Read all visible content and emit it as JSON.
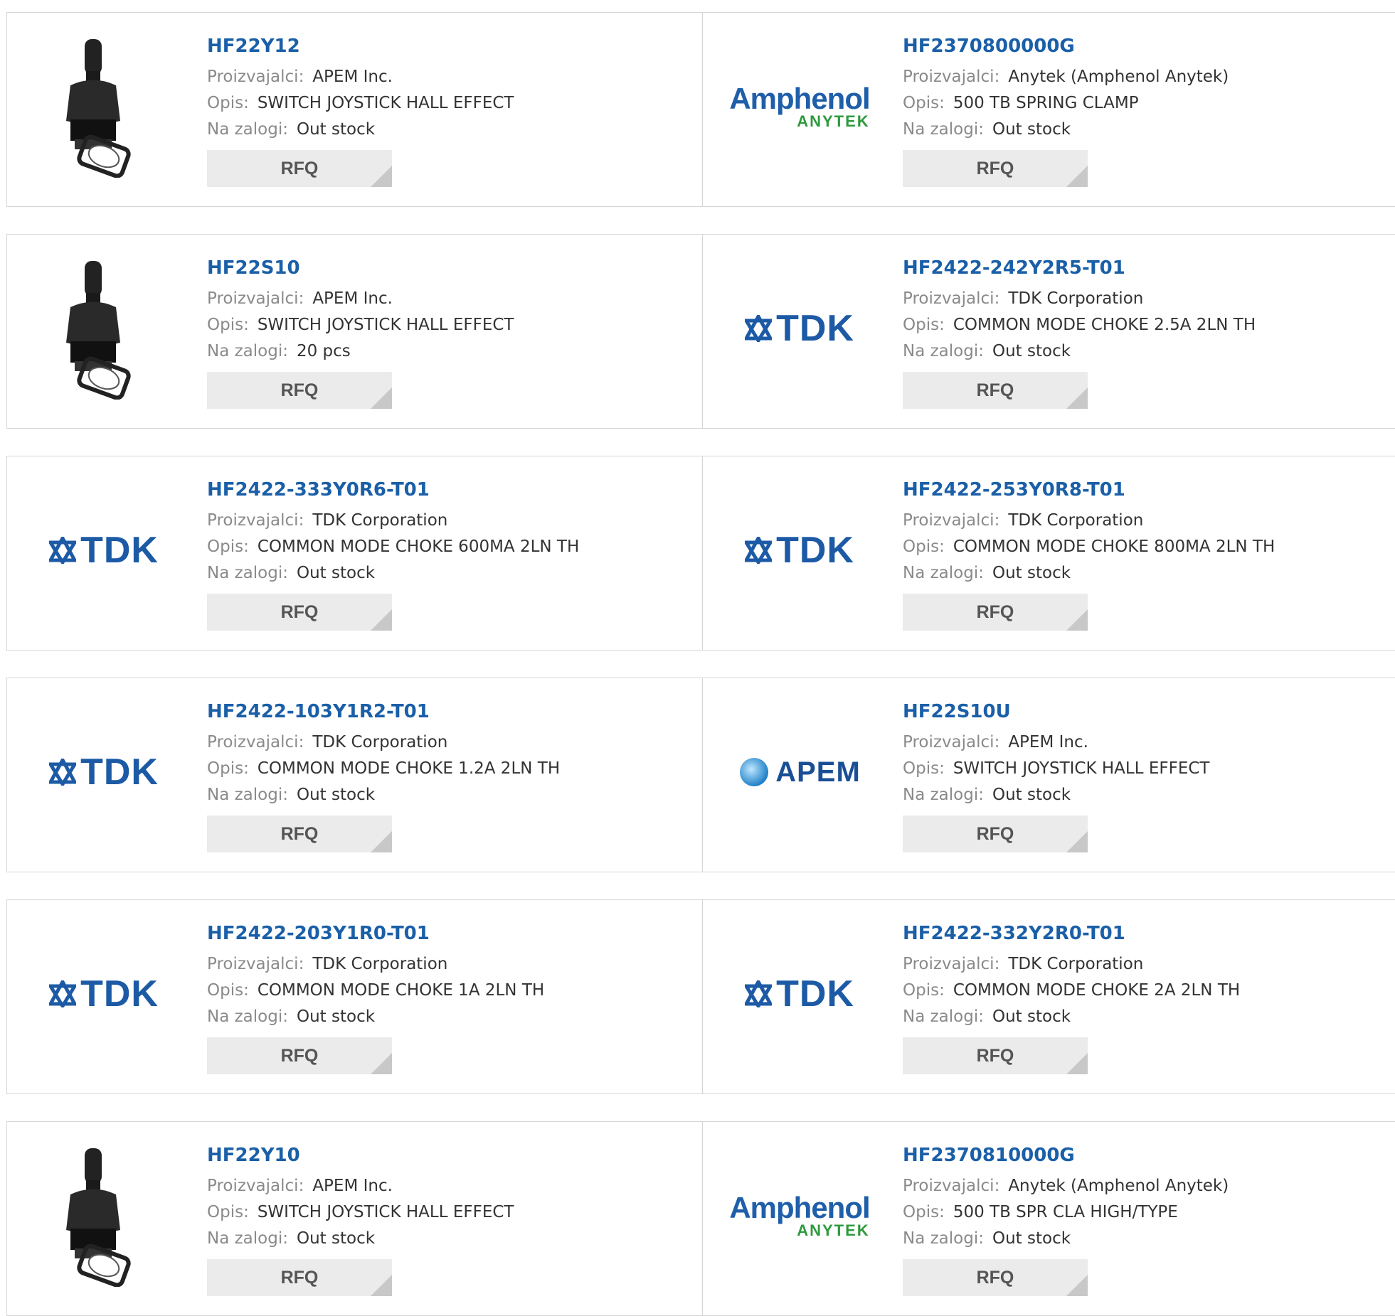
{
  "labels": {
    "manufacturer": "Proizvajalci:",
    "description": "Opis:",
    "stock": "Na zalogi:",
    "rfq": "RFQ"
  },
  "products": [
    {
      "part": "HF22Y12",
      "manufacturer": "APEM Inc.",
      "description": "SWITCH JOYSTICK HALL EFFECT",
      "stock": "Out stock",
      "image": "joystick"
    },
    {
      "part": "HF2370800000G",
      "manufacturer": "Anytek (Amphenol Anytek)",
      "description": "500 TB SPRING CLAMP",
      "stock": "Out stock",
      "image": "amphenol",
      "logo_line1": "Amphenol",
      "logo_line2": "ANYTEK"
    },
    {
      "part": "HF22S10",
      "manufacturer": "APEM Inc.",
      "description": "SWITCH JOYSTICK HALL EFFECT",
      "stock": "20 pcs",
      "image": "joystick"
    },
    {
      "part": "HF2422-242Y2R5-T01",
      "manufacturer": "TDK Corporation",
      "description": "COMMON MODE CHOKE 2.5A 2LN TH",
      "stock": "Out stock",
      "image": "tdk",
      "logo_line1": "TDK"
    },
    {
      "part": "HF2422-333Y0R6-T01",
      "manufacturer": "TDK Corporation",
      "description": "COMMON MODE CHOKE 600MA 2LN TH",
      "stock": "Out stock",
      "image": "tdk",
      "logo_line1": "TDK"
    },
    {
      "part": "HF2422-253Y0R8-T01",
      "manufacturer": "TDK Corporation",
      "description": "COMMON MODE CHOKE 800MA 2LN TH",
      "stock": "Out stock",
      "image": "tdk",
      "logo_line1": "TDK"
    },
    {
      "part": "HF2422-103Y1R2-T01",
      "manufacturer": "TDK Corporation",
      "description": "COMMON MODE CHOKE 1.2A 2LN TH",
      "stock": "Out stock",
      "image": "tdk",
      "logo_line1": "TDK"
    },
    {
      "part": "HF22S10U",
      "manufacturer": "APEM Inc.",
      "description": "SWITCH JOYSTICK HALL EFFECT",
      "stock": "Out stock",
      "image": "apem",
      "logo_line1": "APEM"
    },
    {
      "part": "HF2422-203Y1R0-T01",
      "manufacturer": "TDK Corporation",
      "description": "COMMON MODE CHOKE 1A 2LN TH",
      "stock": "Out stock",
      "image": "tdk",
      "logo_line1": "TDK"
    },
    {
      "part": "HF2422-332Y2R0-T01",
      "manufacturer": "TDK Corporation",
      "description": "COMMON MODE CHOKE 2A 2LN TH",
      "stock": "Out stock",
      "image": "tdk",
      "logo_line1": "TDK"
    },
    {
      "part": "HF22Y10",
      "manufacturer": "APEM Inc.",
      "description": "SWITCH JOYSTICK HALL EFFECT",
      "stock": "Out stock",
      "image": "joystick"
    },
    {
      "part": "HF2370810000G",
      "manufacturer": "Anytek (Amphenol Anytek)",
      "description": "500 TB SPR CLA HIGH/TYPE",
      "stock": "Out stock",
      "image": "amphenol",
      "logo_line1": "Amphenol",
      "logo_line2": "ANYTEK"
    }
  ],
  "colors": {
    "link": "#1a5fa8",
    "tdk": "#1d5aa6",
    "amphenol_blue": "#1f5faa",
    "amphenol_green": "#2e9a3e",
    "apem": "#1a4f95"
  }
}
